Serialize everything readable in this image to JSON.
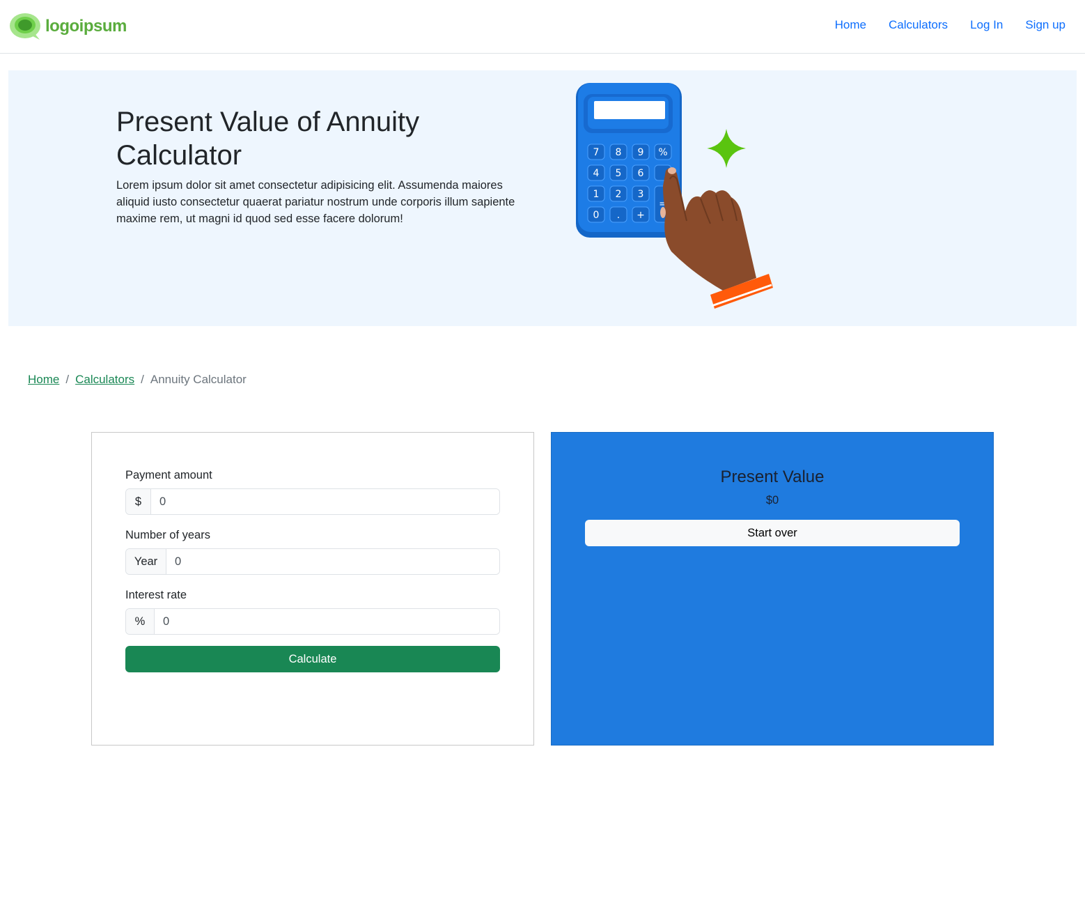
{
  "header": {
    "brand_name": "logoipsum",
    "nav": [
      "Home",
      "Calculators",
      "Log In",
      "Sign up"
    ]
  },
  "hero": {
    "title": "Present Value of Annuity Calculator",
    "description": "Lorem ipsum dolor sit amet consectetur adipisicing elit. Assumenda maiores aliquid iusto consectetur quaerat pariatur nostrum unde corporis illum sapiente maxime rem, ut magni id quod sed esse facere dolorum!",
    "keys": [
      "7",
      "8",
      "9",
      "%",
      "4",
      "5",
      "6",
      "1",
      "2",
      "3",
      "0",
      ".",
      "+",
      "="
    ]
  },
  "breadcrumb": {
    "home": "Home",
    "calculators": "Calculators",
    "current": "Annuity Calculator",
    "separator": "/"
  },
  "form": {
    "payment": {
      "label": "Payment amount",
      "addon": "$",
      "value": "0"
    },
    "years": {
      "label": "Number of years",
      "addon": "Year",
      "value": "0"
    },
    "rate": {
      "label": "Interest rate",
      "addon": "%",
      "value": "0"
    },
    "submit_label": "Calculate"
  },
  "result": {
    "title": "Present Value",
    "value": "$0",
    "reset_label": "Start over"
  },
  "colors": {
    "brand_green": "#5aac3d",
    "link_blue": "#0d6efd",
    "hero_bg": "#eef6fe",
    "breadcrumb_link": "#198754",
    "calculate_button": "#198754",
    "result_bg": "#1f7bdf",
    "calculator_body": "#1d7ce6",
    "sparkle": "#5ac40f",
    "wristband": "#ff5a0a"
  }
}
